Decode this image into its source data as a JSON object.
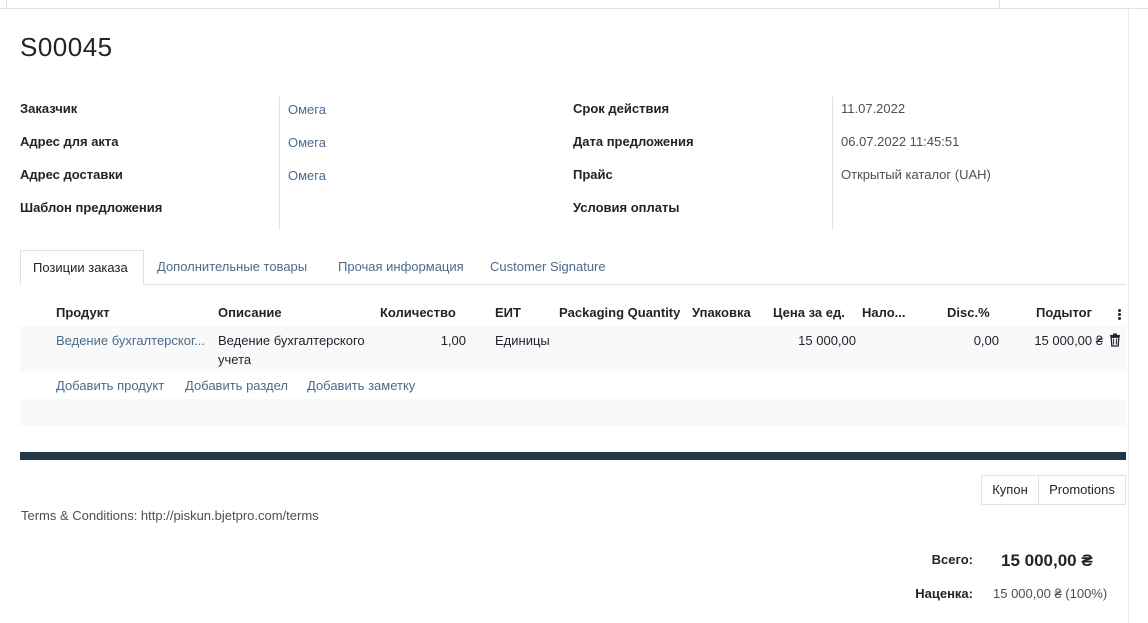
{
  "record": {
    "title": "S00045"
  },
  "left_fields": [
    {
      "label": "Заказчик",
      "value": "Омега"
    },
    {
      "label": "Адрес для акта",
      "value": "Омега"
    },
    {
      "label": "Адрес доставки",
      "value": "Омега"
    },
    {
      "label": "Шаблон предложения",
      "value": ""
    }
  ],
  "right_fields": [
    {
      "label": "Срок действия",
      "value": "11.07.2022"
    },
    {
      "label": "Дата предложения",
      "value": "06.07.2022 11:45:51"
    },
    {
      "label": "Прайс",
      "value": "Открытый каталог (UAH)"
    },
    {
      "label": "Условия оплаты",
      "value": ""
    }
  ],
  "tabs": [
    {
      "label": "Позиции заказа",
      "active": true
    },
    {
      "label": "Дополнительные товары",
      "active": false
    },
    {
      "label": "Прочая информация",
      "active": false
    },
    {
      "label": "Customer Signature",
      "active": false
    }
  ],
  "table": {
    "columns": [
      "Продукт",
      "Описание",
      "Количество",
      "ЕИТ",
      "Packaging Quantity",
      "Упаковка",
      "Цена за ед.",
      "Нало...",
      "Disc.%",
      "Подытог"
    ],
    "rows": [
      {
        "product": "Ведение бухгалтерског...",
        "description_line1": "Ведение бухгалтерского",
        "description_line2": "учета",
        "quantity": "1,00",
        "uom": "Единицы",
        "packaging_qty": "",
        "packaging": "",
        "price_unit": "15 000,00",
        "taxes": "",
        "discount": "0,00",
        "subtotal": "15 000,00 ₴"
      }
    ],
    "add_links": [
      "Добавить продукт",
      "Добавить раздел",
      "Добавить заметку"
    ]
  },
  "buttons": {
    "coupon": "Купон",
    "promotions": "Promotions"
  },
  "terms": "Terms & Conditions: http://piskun.bjetpro.com/terms",
  "totals": {
    "total_label": "Всего:",
    "total_value": "15 000,00 ₴",
    "margin_label": "Наценка:",
    "margin_value": "15 000,00 ₴ (100%)"
  },
  "icons": {
    "delete": "trash-icon",
    "optional_columns": "kebab-menu-icon"
  },
  "colors": {
    "link": "#4c6b8a",
    "dark_bar": "#243746"
  }
}
